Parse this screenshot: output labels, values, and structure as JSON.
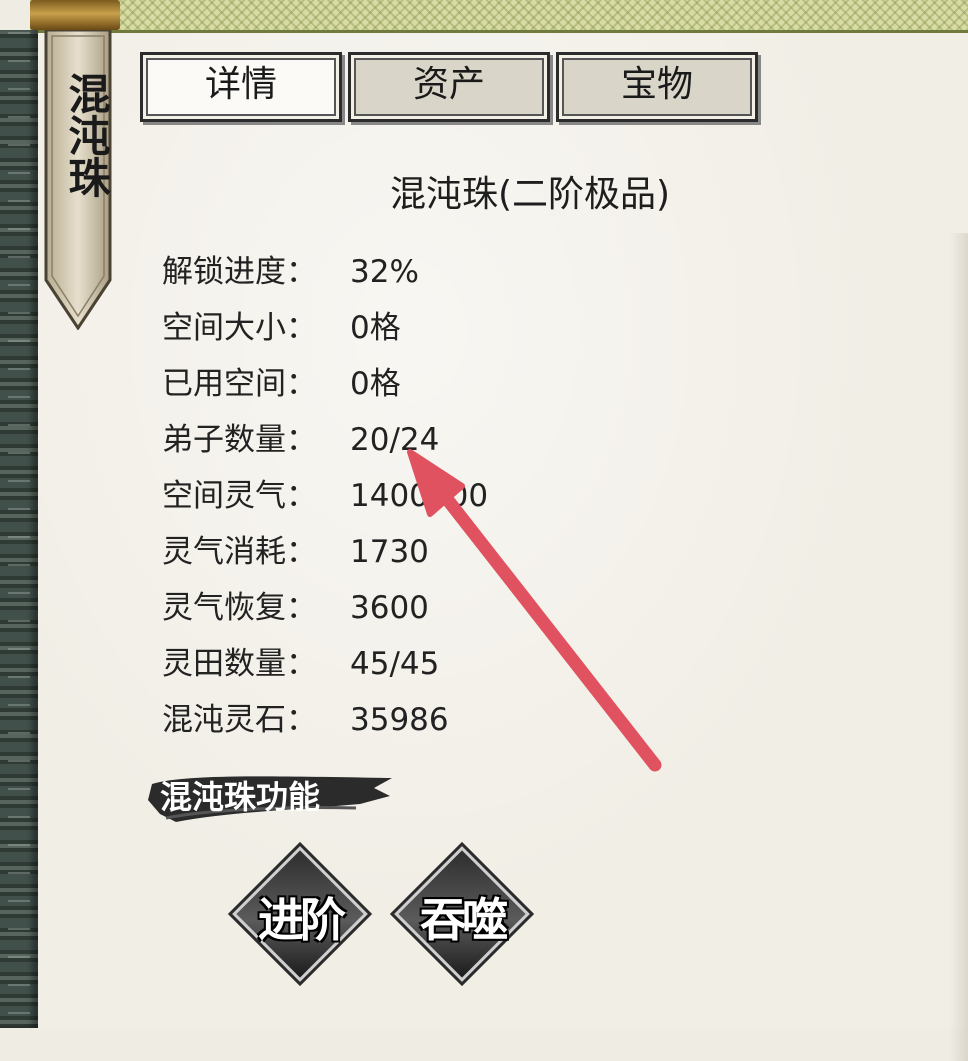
{
  "panel": {
    "title": "混沌珠"
  },
  "tabs": [
    {
      "label": "详情",
      "active": true
    },
    {
      "label": "资产",
      "active": false
    },
    {
      "label": "宝物",
      "active": false
    }
  ],
  "item": {
    "name": "混沌珠(二阶极品)",
    "stats": [
      {
        "label": "解锁进度：",
        "value": "32%"
      },
      {
        "label": "空间大小：",
        "value": "0格"
      },
      {
        "label": "已用空间：",
        "value": "0格"
      },
      {
        "label": "弟子数量：",
        "value": "20/24"
      },
      {
        "label": "空间灵气：",
        "value": "1400000"
      },
      {
        "label": "灵气消耗：",
        "value": "1730"
      },
      {
        "label": "灵气恢复：",
        "value": "3600"
      },
      {
        "label": "灵田数量：",
        "value": "45/45"
      },
      {
        "label": "混沌灵石：",
        "value": "35986"
      }
    ]
  },
  "functions": {
    "section_title": "混沌珠功能",
    "buttons": [
      {
        "label": "进阶"
      },
      {
        "label": "吞噬"
      }
    ]
  },
  "colors": {
    "paper": "#f1eee6",
    "tab_border": "#2c2c2c",
    "arrow": "#e0525f",
    "banner": "#2b2b2b"
  }
}
